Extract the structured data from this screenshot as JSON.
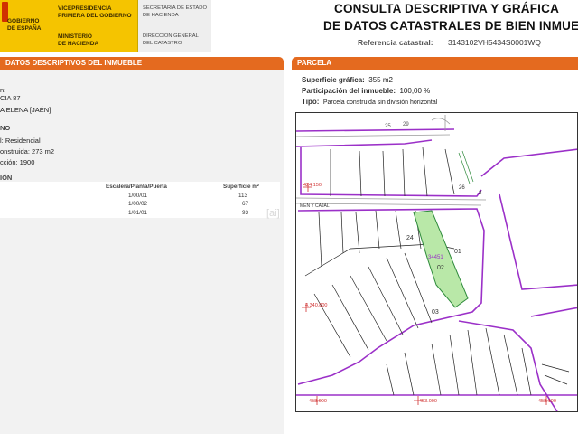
{
  "header": {
    "gobierno": [
      "GOBIERNO",
      "DE ESPAÑA"
    ],
    "vicepresidencia": [
      "VICEPRESIDENCIA",
      "PRIMERA DEL GOBIERNO"
    ],
    "ministerio": [
      "MINISTERIO",
      "DE HACIENDA"
    ],
    "secretaria": [
      "SECRETARÍA DE ESTADO",
      "DE HACIENDA"
    ],
    "direccion": [
      "DIRECCIÓN GENERAL",
      "DEL CATASTRO"
    ],
    "title_line1": "CONSULTA DESCRIPTIVA Y GRÁFICA",
    "title_line2": "DE DATOS CATASTRALES DE BIEN INMUEBLE",
    "ref_label": "Referencia catastral:",
    "ref_value": "3143102VH5434S0001WQ"
  },
  "left_section": {
    "bar_title": "DATOS DESCRIPTIVOS DEL INMUEBLE",
    "lines": [
      "n:",
      "CIA 87",
      "A ELENA [JAÉN]",
      "NO",
      "l:  Residencial",
      "onstruida:  273 m2",
      "cción:  1900",
      "IÓN"
    ],
    "table": {
      "headers": [
        "Escalera/Planta/Puerta",
        "Superficie m²"
      ],
      "rows": [
        [
          "1/00/01",
          "113"
        ],
        [
          "1/00/02",
          "67"
        ],
        [
          "1/01/01",
          "93"
        ]
      ]
    }
  },
  "right_section": {
    "bar_title": "PARCELA",
    "superficie_label": "Superficie gráfica:",
    "superficie_value": "355 m2",
    "participacion_label": "Participación del inmueble:",
    "participacion_value": "100,00 %",
    "tipo_label": "Tipo:",
    "tipo_value": "Parcela construida sin división horizontal"
  },
  "map": {
    "labels": {
      "l25": "25",
      "l29": "29",
      "l26": "26",
      "coord1": "424.150",
      "coord2": "4.340.800",
      "l24": "24",
      "l01": "01",
      "l02": "02",
      "l03": "03",
      "lmh": "34451",
      "calle": "MEN Y CAJAL",
      "l2": "2",
      "x1": "453.000",
      "x2": "453.000",
      "x3": "453.100"
    },
    "watermark": "[ai]"
  },
  "colors": {
    "accent": "#e46a1f",
    "yellow": "#f5c400",
    "parcel_fill": "#b9e8a8",
    "block_line": "#9b30c8"
  }
}
